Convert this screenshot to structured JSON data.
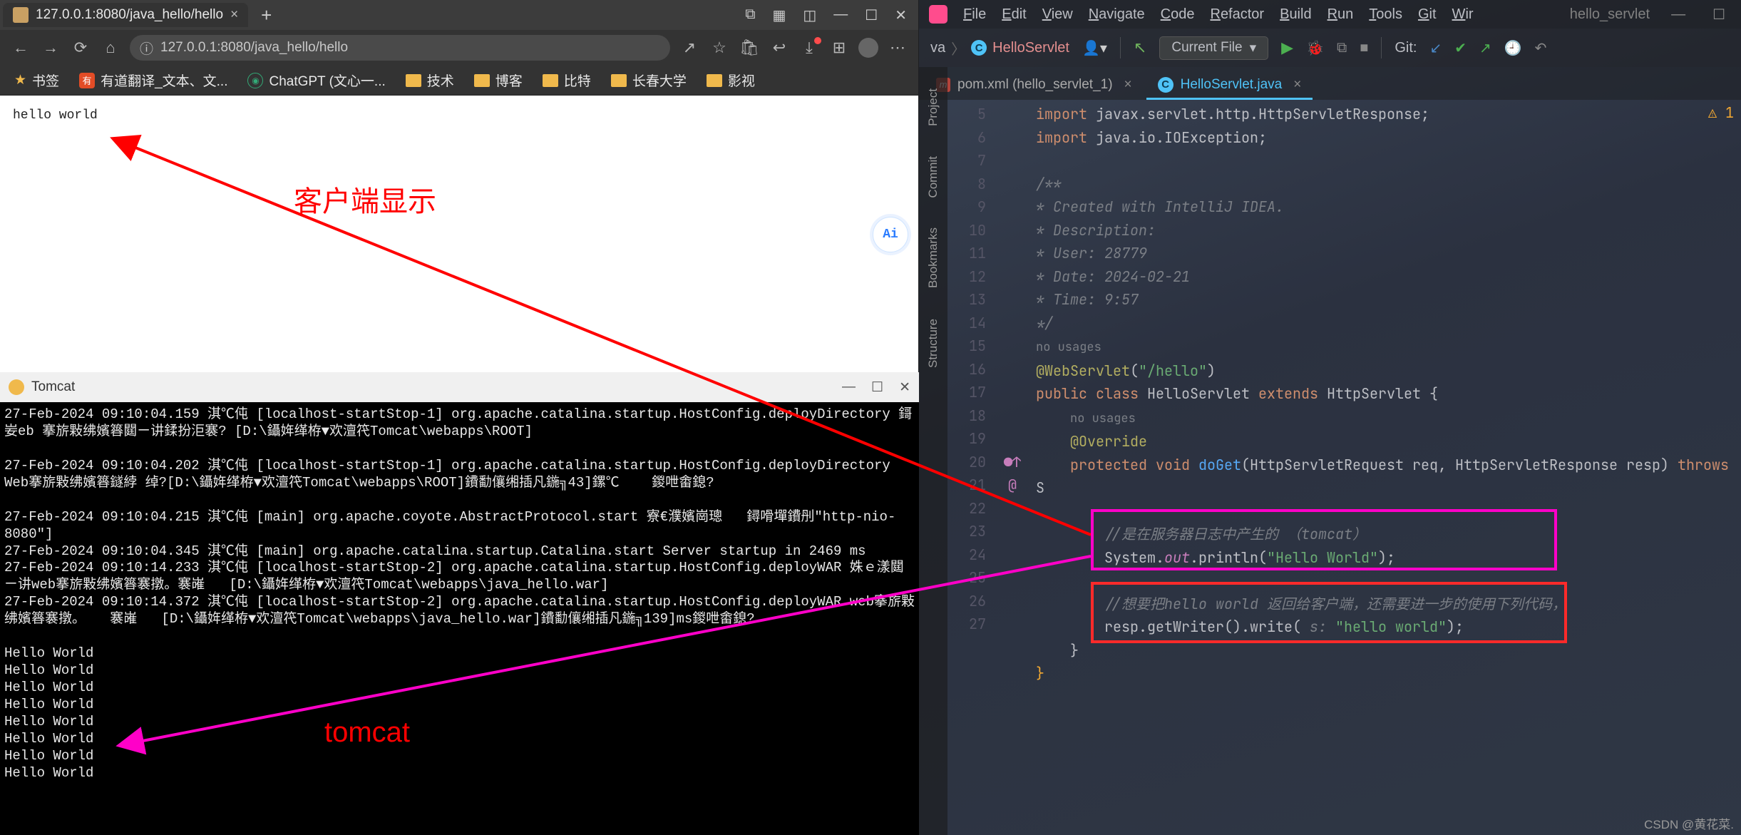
{
  "browser": {
    "tab_title": "127.0.0.1:8080/java_hello/hello",
    "url": "127.0.0.1:8080/java_hello/hello",
    "bookmarks": [
      {
        "icon": "star",
        "label": "书签"
      },
      {
        "icon": "red",
        "label": "有道翻译_文本、文..."
      },
      {
        "icon": "ai",
        "label": "ChatGPT (文心一..."
      },
      {
        "icon": "folder",
        "label": "技术"
      },
      {
        "icon": "folder",
        "label": "博客"
      },
      {
        "icon": "folder",
        "label": "比特"
      },
      {
        "icon": "folder",
        "label": "长春大学"
      },
      {
        "icon": "folder",
        "label": "影视"
      }
    ],
    "page_text": "hello world",
    "ai_badge": "Ai"
  },
  "console": {
    "title": "Tomcat",
    "lines": [
      "27-Feb-2024 09:10:04.159 淇℃伅 [localhost-startStop-1] org.apache.catalina.startup.HostConfig.deployDirectory 鎶妛eb 搴旂敤绋嬪簭閮ㄧ讲鍒扮洰褰? [D:\\鑷姩缂栫▼欢澶笩Tomcat\\webapps\\ROOT]",
      "",
      "27-Feb-2024 09:10:04.202 淇℃伅 [localhost-startStop-1] org.apache.catalina.startup.HostConfig.deployDirectory Web搴旂敤绋嬪簭鐩綍 绰?[D:\\鑷姩缂栫▼欢澶笩Tomcat\\webapps\\ROOT]鐨勫儴缃插凡鍦╗43]鏍℃    鍐呭畬鎴?",
      "",
      "27-Feb-2024 09:10:04.215 淇℃伅 [main] org.apache.coyote.AbstractProtocol.start 寮€濮嬪崗璁   鐞嗗墠鐨刐\"http-nio-8080\"]",
      "27-Feb-2024 09:10:04.345 淇℃伅 [main] org.apache.catalina.startup.Catalina.start Server startup in 2469 ms",
      "27-Feb-2024 09:10:14.233 淇℃伅 [localhost-startStop-2] org.apache.catalina.startup.HostConfig.deployWAR 姝ｅ漾閮ㄧ讲web搴旂敤绋嬪簭褰撴。褰嶉   [D:\\鑷姩缂栫▼欢澶笩Tomcat\\webapps\\java_hello.war]",
      "27-Feb-2024 09:10:14.372 淇℃伅 [localhost-startStop-2] org.apache.catalina.startup.HostConfig.deployWAR web搴旂敤绋嬪簭褰撴。   褰嶉   [D:\\鑷姩缂栫▼欢澶笩Tomcat\\webapps\\java_hello.war]鐨勫儴缃插凡鍦╗139]ms鍐呭畬鎴?",
      "",
      "Hello World",
      "Hello World",
      "Hello World",
      "Hello World",
      "Hello World",
      "Hello World",
      "Hello World",
      "Hello World"
    ]
  },
  "ide": {
    "menus": [
      "File",
      "Edit",
      "View",
      "Navigate",
      "Code",
      "Refactor",
      "Build",
      "Run",
      "Tools",
      "Git",
      "Wir"
    ],
    "project_name": "hello_servlet",
    "breadcrumb_suffix": "va",
    "breadcrumb_class": "HelloServlet",
    "run_config": "Current File",
    "git_label": "Git:",
    "tabs": [
      {
        "icon": "maven",
        "label": "pom.xml (hello_servlet_1)",
        "active": false
      },
      {
        "icon": "class",
        "label": "HelloServlet.java",
        "active": true
      }
    ],
    "side_tools": [
      "Project",
      "Commit",
      "Bookmarks",
      "Structure"
    ],
    "warn_count": "1",
    "line_start": 5,
    "code_lines": [
      {
        "n": 5,
        "html": "<span class='kw'>import</span> javax.servlet.http.HttpServletResponse;"
      },
      {
        "n": 6,
        "html": "<span class='kw'>import</span> java.io.IOException;"
      },
      {
        "n": 7,
        "html": ""
      },
      {
        "n": 8,
        "html": "<span class='com'>/**</span>"
      },
      {
        "n": 9,
        "html": "<span class='com'> * Created with IntelliJ IDEA.</span>"
      },
      {
        "n": 10,
        "html": "<span class='com'> * Description:</span>"
      },
      {
        "n": 11,
        "html": "<span class='com'> * User: 28779</span>"
      },
      {
        "n": 12,
        "html": "<span class='com'> * Date: 2024-02-21</span>"
      },
      {
        "n": 13,
        "html": "<span class='com'> * Time: 9:57</span>"
      },
      {
        "n": 14,
        "html": "<span class='com'> */</span>"
      },
      {
        "n": "",
        "html": "<span class='usage'>no usages</span>"
      },
      {
        "n": 15,
        "html": "<span class='anno'>@WebServlet</span>(<span class='str'>\"/hello\"</span>)"
      },
      {
        "n": 16,
        "html": "<span class='kw'>public class</span> <span class='cls'>HelloServlet</span> <span class='kw'>extends</span> <span class='cls'>HttpServlet</span> {"
      },
      {
        "n": "",
        "html": "&nbsp;&nbsp;&nbsp;&nbsp;<span class='usage'>no usages</span>"
      },
      {
        "n": 17,
        "html": "&nbsp;&nbsp;&nbsp;&nbsp;<span class='anno'>@Override</span>"
      },
      {
        "n": 18,
        "mark": "●↑ @",
        "html": "&nbsp;&nbsp;&nbsp;&nbsp;<span class='kw'>protected</span> <span class='kw'>void</span> <span class='fn'>doGet</span>(HttpServletRequest <span class='param'>req</span>, HttpServletResponse <span class='param'>resp</span>) <span class='kw'>throws</span> S"
      },
      {
        "n": 19,
        "html": ""
      },
      {
        "n": 20,
        "html": "&nbsp;&nbsp;&nbsp;&nbsp;&nbsp;&nbsp;&nbsp;&nbsp;<span class='com'>//是在服务器日志中产生的  （tomcat）</span>"
      },
      {
        "n": 21,
        "html": "&nbsp;&nbsp;&nbsp;&nbsp;&nbsp;&nbsp;&nbsp;&nbsp;System.<span class='field'>out</span>.println(<span class='str'>\"Hello World\"</span>);"
      },
      {
        "n": 22,
        "html": ""
      },
      {
        "n": 23,
        "html": "&nbsp;&nbsp;&nbsp;&nbsp;&nbsp;&nbsp;&nbsp;&nbsp;<span class='com'>//想要把hello world  返回给客户端，还需要进一步的使用下列代码，</span>"
      },
      {
        "n": 24,
        "html": "&nbsp;&nbsp;&nbsp;&nbsp;&nbsp;&nbsp;&nbsp;&nbsp;resp.getWriter().write( <span class='com'>s:</span> <span class='str'>\"hello world\"</span>);"
      },
      {
        "n": 25,
        "html": "&nbsp;&nbsp;&nbsp;&nbsp;}"
      },
      {
        "n": 26,
        "html": "<span style='color:#f0a732'>}</span>"
      },
      {
        "n": 27,
        "html": ""
      }
    ]
  },
  "annotations": {
    "label_client": "客户端显示",
    "label_tomcat": "tomcat",
    "watermark": "CSDN @黄花菜."
  }
}
